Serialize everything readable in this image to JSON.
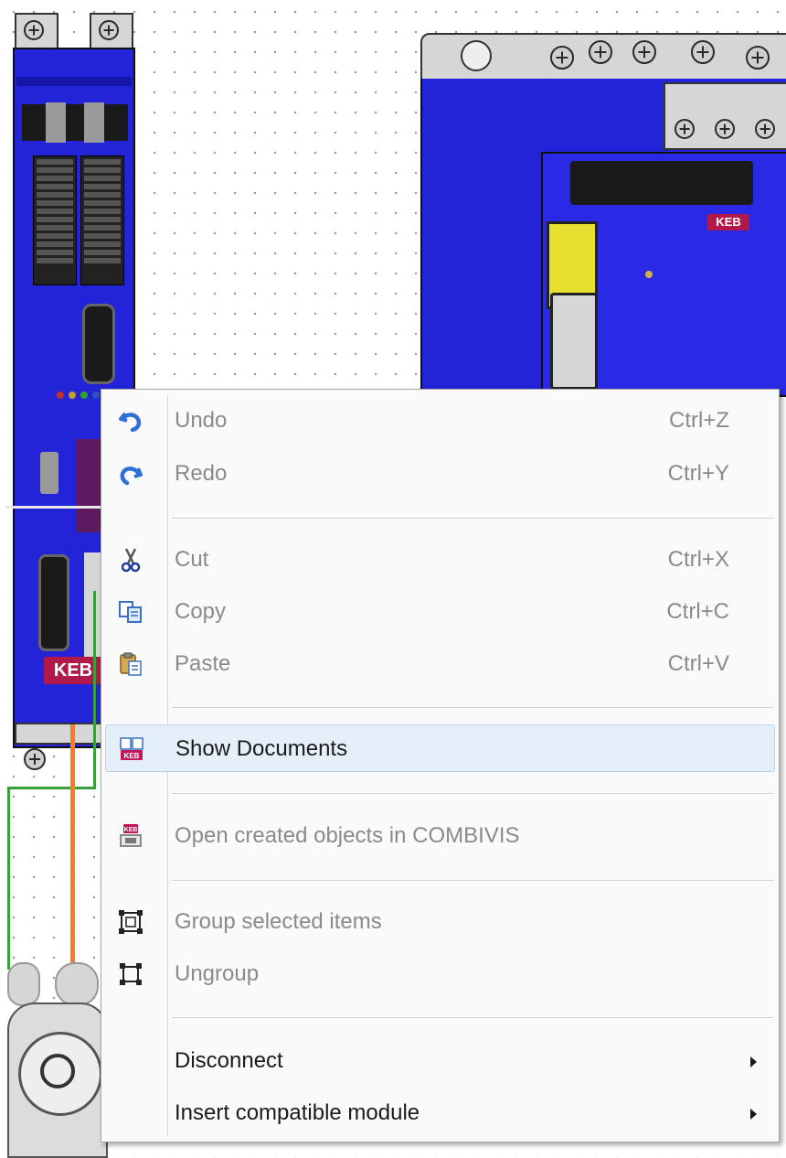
{
  "menu": {
    "undo": {
      "label": "Undo",
      "shortcut": "Ctrl+Z",
      "icon": "undo-icon"
    },
    "redo": {
      "label": "Redo",
      "shortcut": "Ctrl+Y",
      "icon": "redo-icon"
    },
    "cut": {
      "label": "Cut",
      "shortcut": "Ctrl+X",
      "icon": "scissors-icon"
    },
    "copy": {
      "label": "Copy",
      "shortcut": "Ctrl+C",
      "icon": "copy-icon"
    },
    "paste": {
      "label": "Paste",
      "shortcut": "Ctrl+V",
      "icon": "paste-icon"
    },
    "show_documents": {
      "label": "Show Documents",
      "icon": "documents-keb-icon"
    },
    "open_combivis": {
      "label": "Open created objects in COMBIVIS",
      "icon": "combivis-icon"
    },
    "group": {
      "label": "Group selected items",
      "icon": "group-icon"
    },
    "ungroup": {
      "label": "Ungroup",
      "icon": "ungroup-icon"
    },
    "disconnect": {
      "label": "Disconnect",
      "icon": "submenu-arrow-icon"
    },
    "insert_module": {
      "label": "Insert compatible module",
      "icon": "submenu-arrow-icon"
    }
  },
  "canvas": {
    "left_drive_logo": "KEB",
    "right_drive_logo": "KEB"
  },
  "colors": {
    "drive_blue": "#2323d8",
    "logo_red": "#b0194a",
    "menu_highlight": "#e4eff9",
    "wire_orange": "#ff7a1f",
    "wire_green": "#39a039"
  }
}
